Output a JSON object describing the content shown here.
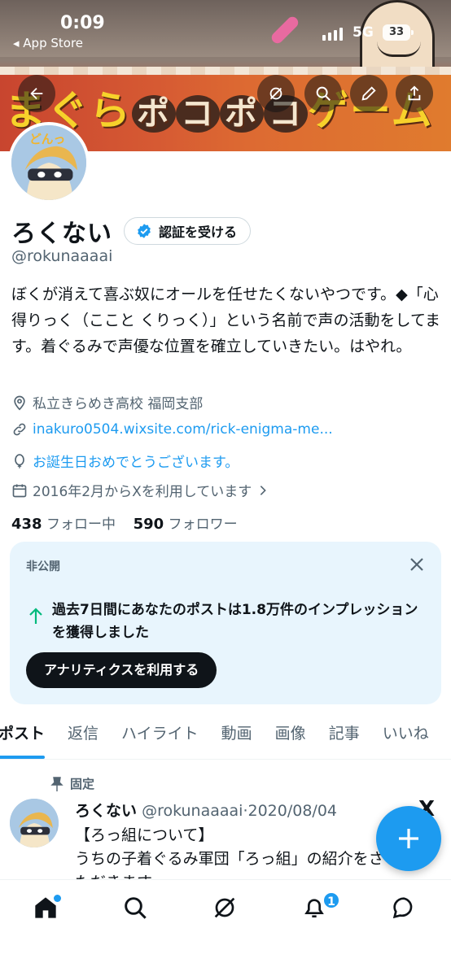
{
  "status_bar": {
    "time": "0:09",
    "back_app": "◂ App Store",
    "network": "5G",
    "battery": "33"
  },
  "banner": {
    "title_part1": "まぐら",
    "title_poko1": "ポ",
    "title_ko1": "コ",
    "title_poko2": "ポ",
    "title_ko2": "コ",
    "title_part2": "ゲーム"
  },
  "profile": {
    "display_name": "ろくない",
    "verify_label": "認証を受ける",
    "handle": "@rokunaaaai",
    "avatar_text": "どんっ",
    "bio": "ぼくが消えて喜ぶ奴にオールを任せたくないやつです。◆「心得りっく（ここと くりっく）」という名前で声の活動をしてます。着ぐるみで声優な位置を確立していきたい。はやれ。",
    "location": "私立きらめき高校 福岡支部",
    "link": "inakuro0504.wixsite.com/rick-enigma-me...",
    "birthday": "お誕生日おめでとうございます。",
    "joined": "2016年2月からXを利用しています",
    "following_count": "438",
    "following_label": "フォロー中",
    "followers_count": "590",
    "followers_label": "フォロワー"
  },
  "analytics": {
    "private_label": "非公開",
    "impressions_text": "過去7日間にあなたのポストは1.8万件のインプレッションを獲得しました",
    "cta_label": "アナリティクスを利用する"
  },
  "tabs": [
    "ポスト",
    "返信",
    "ハイライト",
    "動画",
    "画像",
    "記事",
    "いいね"
  ],
  "pinned_post": {
    "pinned_label": "固定",
    "author": "ろくない",
    "handle": "@rokunaaaai",
    "date": "2020/08/04",
    "line1": "【ろっ組について】",
    "line2": "うちの子着ぐるみ軍団「ろっ組」の紹介をさせていただきます",
    "x_logo": "X"
  },
  "bottom_nav": {
    "notification_count": "1"
  },
  "colors": {
    "accent": "#1d9bf0",
    "text_primary": "#0f1419",
    "text_secondary": "#536471",
    "card_bg": "#e8f5fd"
  },
  "icons": [
    "back-arrow-icon",
    "grok-icon",
    "search-icon",
    "edit-icon",
    "share-icon",
    "verified-badge-icon",
    "location-icon",
    "link-icon",
    "balloon-icon",
    "calendar-icon",
    "chevron-right-icon",
    "close-icon",
    "up-arrow-icon",
    "pin-icon",
    "plus-icon",
    "home-icon",
    "notifications-icon",
    "messages-icon"
  ]
}
